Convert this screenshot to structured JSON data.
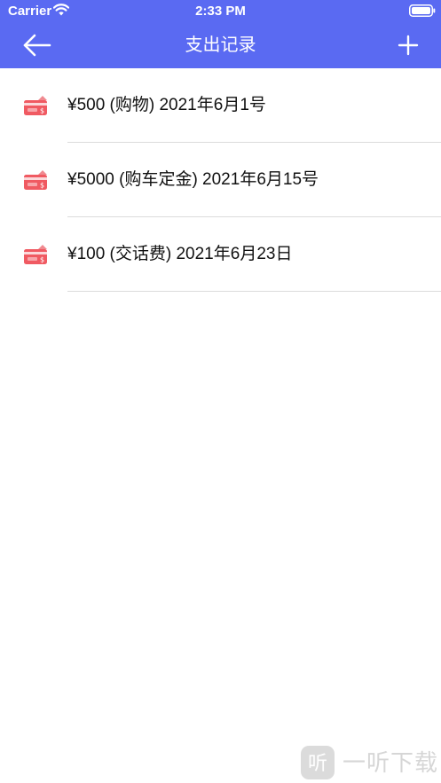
{
  "status_bar": {
    "carrier": "Carrier",
    "time": "2:33 PM",
    "wifi_icon": "wifi-icon",
    "battery_icon": "battery-icon"
  },
  "nav": {
    "title": "支出记录",
    "back_icon": "arrow-left-icon",
    "add_icon": "plus-icon"
  },
  "colors": {
    "nav_background": "#5a6af2",
    "icon_red": "#f05a62",
    "separator": "#dcdcdc"
  },
  "records": [
    {
      "text": "¥500 (购物) 2021年6月1号",
      "icon": "money-card-icon"
    },
    {
      "text": "¥5000 (购车定金) 2021年6月15号",
      "icon": "money-card-icon"
    },
    {
      "text": "¥100 (交话费) 2021年6月23日",
      "icon": "money-card-icon"
    }
  ],
  "watermark": {
    "text": "一听下载",
    "logo_glyph": "听"
  }
}
